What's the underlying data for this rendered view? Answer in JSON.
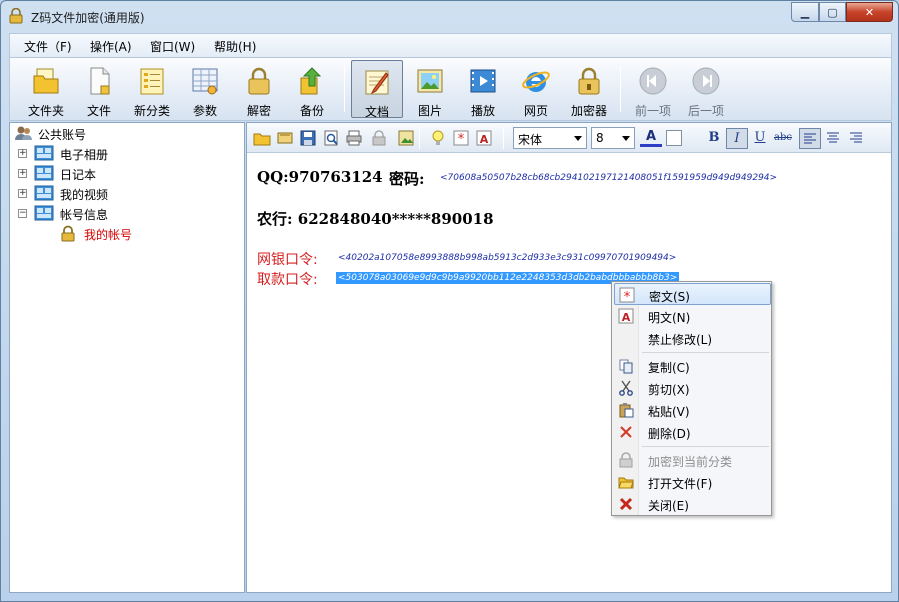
{
  "window": {
    "title": "Z码文件加密(通用版)"
  },
  "menu": [
    "文件（F)",
    "操作(A)",
    "窗口(W)",
    "帮助(H)"
  ],
  "toolbar": [
    {
      "label": "文件夹",
      "icon": "folder-icon"
    },
    {
      "label": "文件",
      "icon": "file-icon"
    },
    {
      "label": "新分类",
      "icon": "new-category-icon"
    },
    {
      "label": "参数",
      "icon": "settings-icon"
    },
    {
      "label": "解密",
      "icon": "unlock-icon"
    },
    {
      "label": "备份",
      "icon": "backup-icon"
    },
    {
      "label": "文档",
      "icon": "document-icon"
    },
    {
      "label": "图片",
      "icon": "image-icon"
    },
    {
      "label": "播放",
      "icon": "play-icon"
    },
    {
      "label": "网页",
      "icon": "browser-icon"
    },
    {
      "label": "加密器",
      "icon": "encryptor-icon"
    },
    {
      "label": "前一项",
      "icon": "previous-icon"
    },
    {
      "label": "后一项",
      "icon": "next-icon"
    }
  ],
  "tree": {
    "root": "公共账号",
    "nodes": [
      "电子相册",
      "日记本",
      "我的视频",
      "帐号信息"
    ],
    "child": "我的帐号"
  },
  "editor_toolbar": {
    "font": "宋体",
    "size": "8"
  },
  "content": {
    "qq_label": "QQ:970763124",
    "pwd_label": "密码:",
    "pwd_cipher": "<70608a50507b28cb68cb294102197121408051f1591959d949d949294>",
    "bank_line": "农行: 622848040*****890018",
    "ebank_label": "网银口令:",
    "ebank_cipher": "<40202a107058e8993888b998ab5913c2d933e3c931c09970701909494>",
    "withdraw_label": "取款口令:",
    "withdraw_cipher": "<503078a03069e9d9c9b9a9920bb112e2248353d3db2babdbbbabbb8b3>"
  },
  "context_menu": [
    {
      "label": "密文(S)",
      "icon": "cipher-icon"
    },
    {
      "label": "明文(N)",
      "icon": "plaintext-icon"
    },
    {
      "label": "禁止修改(L)",
      "icon": ""
    },
    {
      "label": "复制(C)",
      "icon": "copy-icon"
    },
    {
      "label": "剪切(X)",
      "icon": "cut-icon"
    },
    {
      "label": "粘贴(V)",
      "icon": "paste-icon"
    },
    {
      "label": "删除(D)",
      "icon": "delete-icon"
    },
    {
      "label": "加密到当前分类",
      "icon": "lock-icon"
    },
    {
      "label": "打开文件(F)",
      "icon": "open-folder-icon"
    },
    {
      "label": "关闭(E)",
      "icon": "close-icon"
    }
  ],
  "colors": {
    "accent": "#3399ff",
    "selection": "#3399ff",
    "label_red": "#d42020",
    "cipher_blue": "#1f2fa8",
    "tree_selected": "#d40000"
  }
}
